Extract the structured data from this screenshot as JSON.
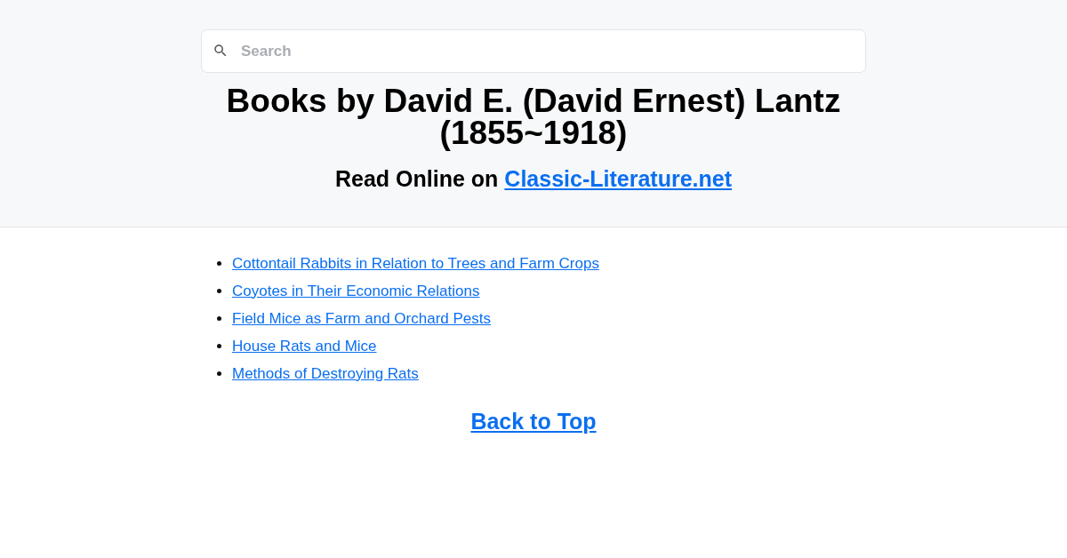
{
  "search": {
    "placeholder": "Search"
  },
  "title": "Books by David E. (David Ernest) Lantz (1855~1918)",
  "subtitle": {
    "text": "Read Online on",
    "link": "Classic-Literature.net"
  },
  "books": [
    {
      "title": "Cottontail Rabbits in Relation to Trees and Farm Crops"
    },
    {
      "title": "Coyotes in Their Economic Relations"
    },
    {
      "title": "Field Mice as Farm and Orchard Pests"
    },
    {
      "title": "House Rats and Mice"
    },
    {
      "title": "Methods of Destroying Rats"
    }
  ],
  "back_link": "Back to Top"
}
